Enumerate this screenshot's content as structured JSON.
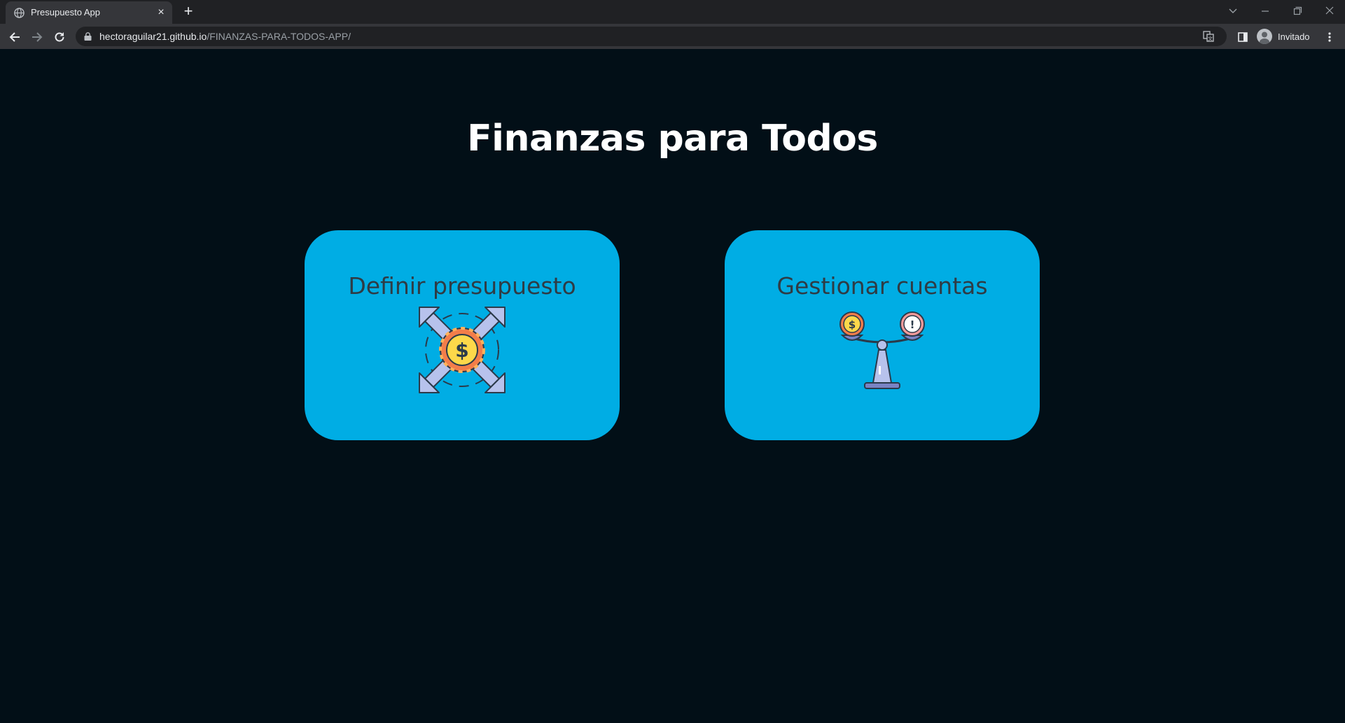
{
  "browser": {
    "tab_title": "Presupuesto App",
    "tab_close": "×",
    "new_tab": "+",
    "url_host": "hectoraguilar21.github.io",
    "url_path": "/FINANZAS-PARA-TODOS-APP/",
    "profile_label": "Invitado"
  },
  "page": {
    "title": "Finanzas para Todos",
    "cards": [
      {
        "label": "Definir presupuesto",
        "icon": "budget-arrows-coin-icon"
      },
      {
        "label": "Gestionar cuentas",
        "icon": "balance-scale-icon"
      }
    ]
  },
  "colors": {
    "page_background": "#020f17",
    "card_background": "#00ade4",
    "title_text": "#ffffff",
    "card_text": "#2f3b44"
  }
}
